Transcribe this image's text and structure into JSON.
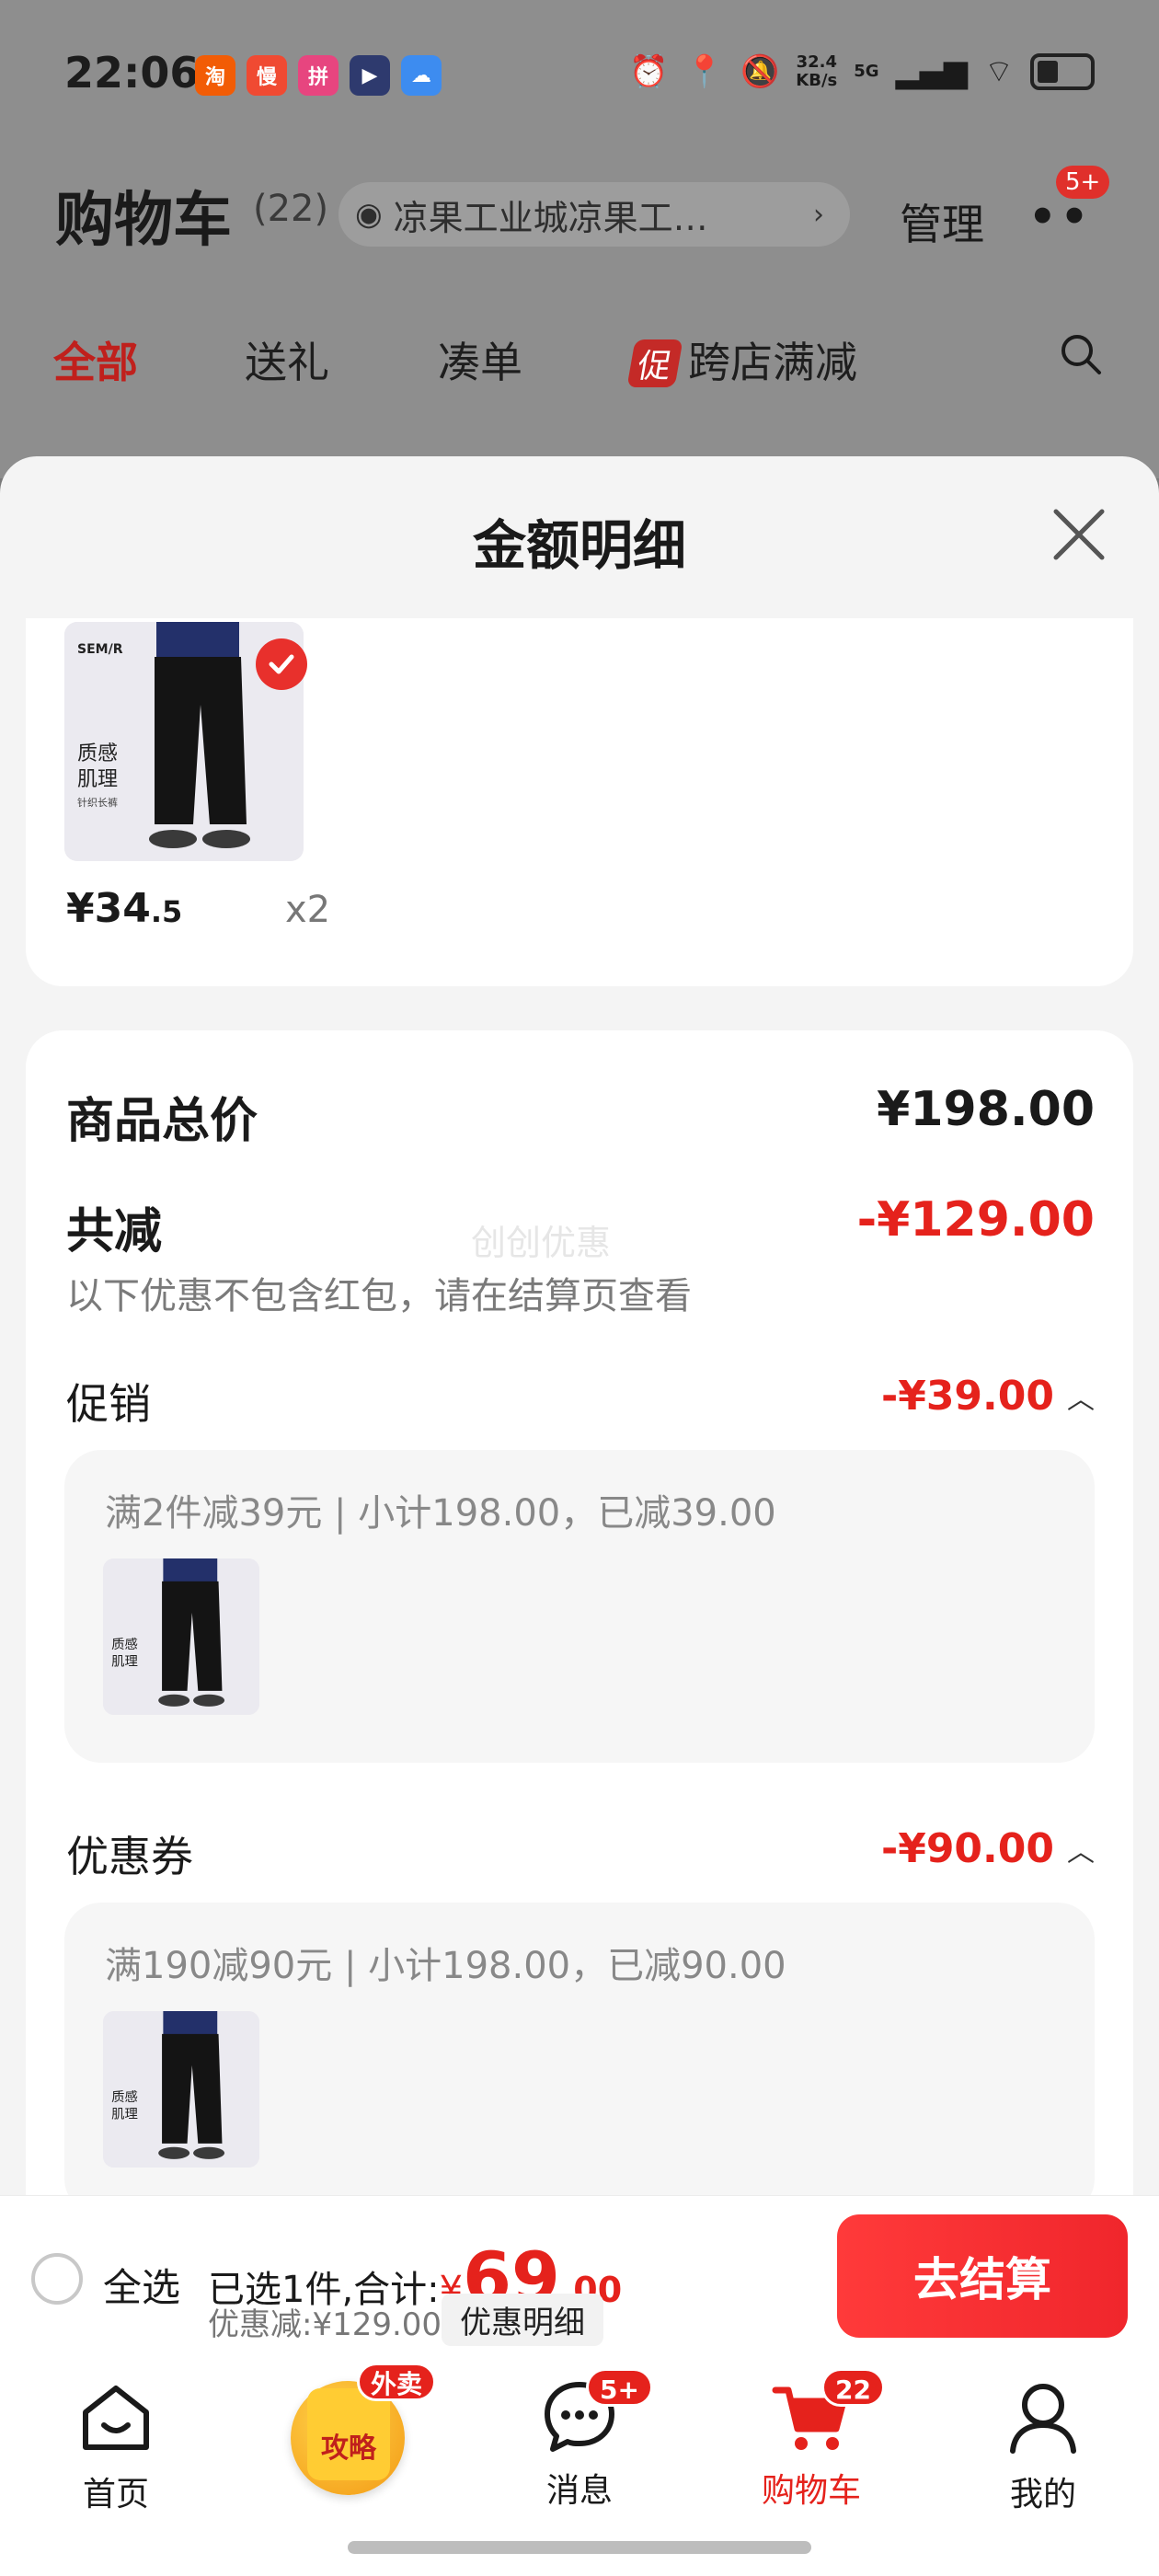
{
  "status_bar": {
    "time": "22:06",
    "net_speed_value": "32.4",
    "net_speed_unit": "KB/s",
    "signal": "5G",
    "apps": [
      {
        "icon": "taobao-app-icon",
        "glyph": "淘",
        "color": "#f25c05"
      },
      {
        "icon": "xianyu-app-icon",
        "glyph": "慢",
        "color": "#f04a32"
      },
      {
        "icon": "pinduoduo-app-icon",
        "glyph": "拼",
        "color": "#e7457f"
      },
      {
        "icon": "video-app-icon",
        "glyph": "▶",
        "color": "#2e3a6e"
      },
      {
        "icon": "cloud-app-icon",
        "glyph": "☁",
        "color": "#3d8cf0"
      }
    ]
  },
  "header": {
    "title": "购物车",
    "count": "(22)",
    "address": "凉果工业城凉果工…",
    "manage_label": "管理",
    "more_badge": "5+"
  },
  "tabs": [
    {
      "label": "全部",
      "active": true
    },
    {
      "label": "送礼",
      "active": false
    },
    {
      "label": "凑单",
      "active": false
    },
    {
      "label": "跨店满减",
      "badge": "促",
      "active": false
    }
  ],
  "sheet": {
    "title": "金额明细",
    "product": {
      "image_brand": "SEM/R",
      "image_caption": "质感\n肌理",
      "image_sub": "针织长裤",
      "price_main": "¥34",
      "price_decimal": ".5",
      "qty": "x2"
    },
    "summary": {
      "total_label": "商品总价",
      "total_value": "¥198.00",
      "reduce_label": "共减",
      "reduce_value": "-¥129.00",
      "reduce_note": "以下优惠不包含红包，请在结算页查看",
      "watermark": "创创优惠"
    },
    "promotion": {
      "label": "促销",
      "value": "-¥39.00",
      "detail": "满2件减39元 | 小计198.00，已减39.00"
    },
    "coupon": {
      "label": "优惠券",
      "value": "-¥90.00",
      "detail": "满190减90元 | 小计198.00，已减90.00"
    }
  },
  "checkout": {
    "select_all": "全选",
    "selected_prefix": "已选1件,合计:",
    "yen": "¥",
    "total_int": "69",
    "total_dec": ".00",
    "discount_text": "优惠减:¥129.00",
    "detail_chip": "优惠明细",
    "button": "去结算"
  },
  "bottom_nav": {
    "items": [
      {
        "label": "首页"
      },
      {
        "label": "攻略",
        "badge": "外卖"
      },
      {
        "label": "消息",
        "badge": "5+"
      },
      {
        "label": "购物车",
        "badge": "22",
        "active": true
      },
      {
        "label": "我的"
      }
    ]
  },
  "colors": {
    "accent_red": "#e5221c",
    "sheet_bg": "#f4f4f4"
  }
}
